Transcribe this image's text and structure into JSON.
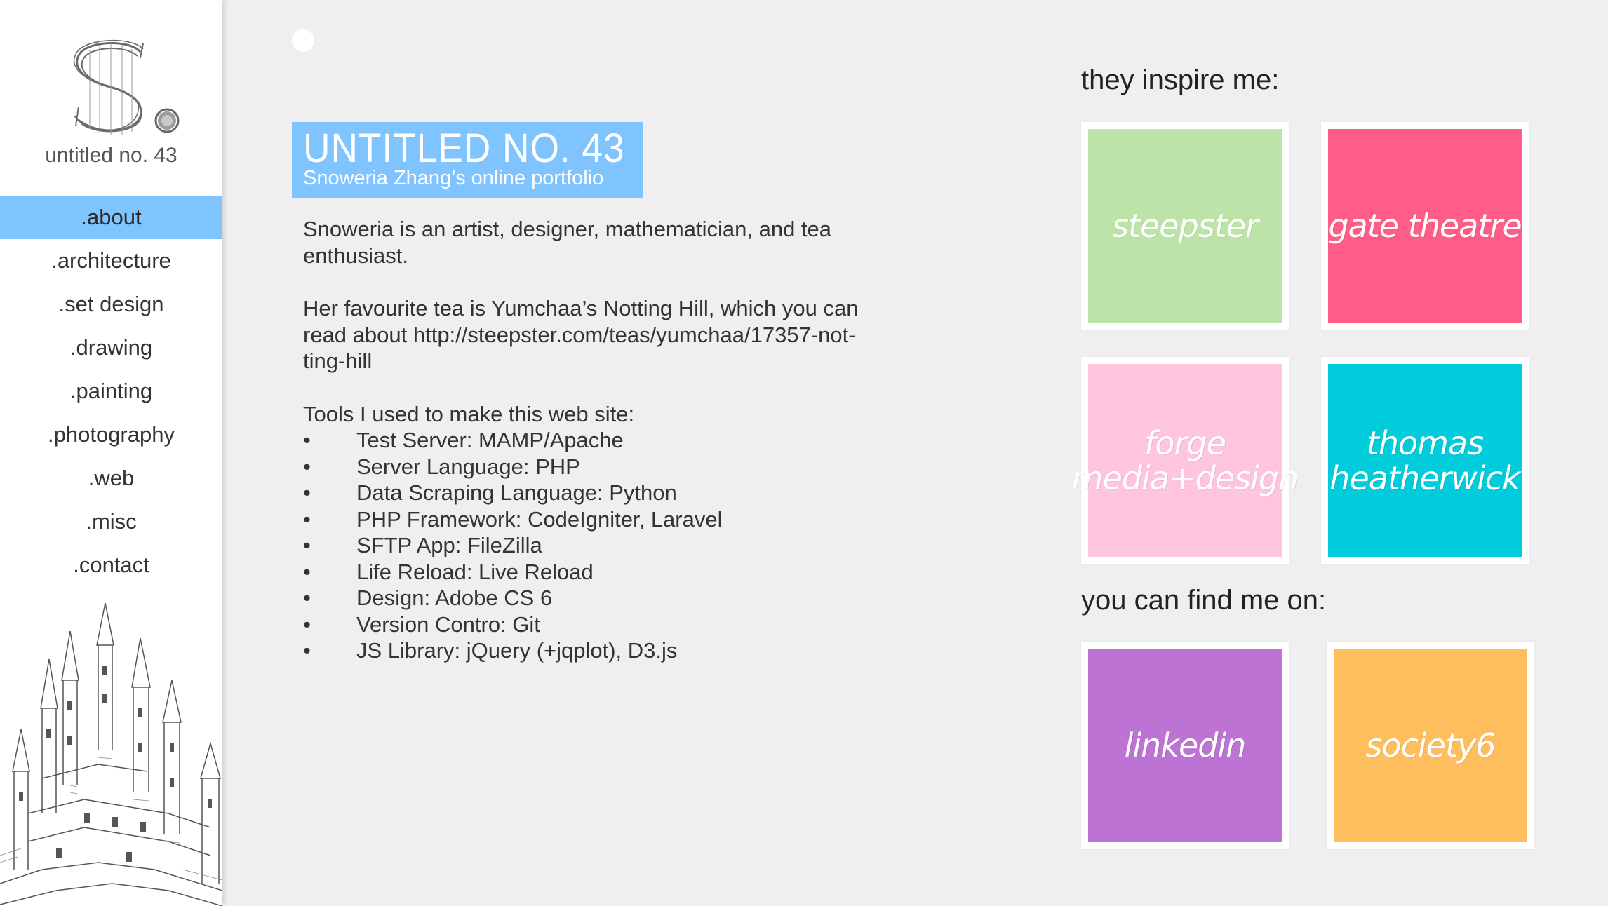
{
  "sidebar": {
    "logo_text": "S.",
    "site_name": "untitled no. 43",
    "nav": [
      {
        "label": ".about",
        "active": true
      },
      {
        "label": ".architecture"
      },
      {
        "label": ".set design"
      },
      {
        "label": ".drawing"
      },
      {
        "label": ".painting"
      },
      {
        "label": ".photography"
      },
      {
        "label": ".web"
      },
      {
        "label": ".misc"
      },
      {
        "label": ".contact"
      }
    ]
  },
  "header": {
    "title": "UNTITLED NO. 43",
    "subtitle": "Snoweria Zhang’s online portfolio"
  },
  "about": {
    "intro": "Snoweria is an artist, designer, mathematician, and tea enthusiast.",
    "tea_line1": "Her favourite tea is Yumchaa’s Notting Hill, which you can",
    "tea_line2": "read about http://steepster.com/teas/yumchaa/17357-not-",
    "tea_line3": "ting-hill",
    "tools_heading": "Tools I used to make this web site:",
    "bullet": "•",
    "tools": [
      "Test Server: MAMP/Apache",
      "Server Language: PHP",
      "Data Scraping Language: Python",
      "PHP Framework: CodeIgniter, Laravel",
      "SFTP App: FileZilla",
      "Life Reload: Live Reload",
      "Design: Adobe CS 6",
      "Version Contro: Git",
      "JS Library: jQuery (+jqplot), D3.js"
    ]
  },
  "inspire": {
    "heading": "they inspire me:",
    "tiles": [
      {
        "label": "steepster",
        "color": "#bde4a8"
      },
      {
        "label": "gate theatre",
        "color": "#ff5d87"
      },
      {
        "label": "forge media+design",
        "line1": "forge",
        "line2": "media+design",
        "color": "#ffc4de"
      },
      {
        "label": "thomas heatherwick",
        "line1": "thomas",
        "line2": "heatherwick",
        "color": "#00ccdb"
      }
    ]
  },
  "find": {
    "heading": "you can find me on:",
    "tiles": [
      {
        "label": "linkedin",
        "color": "#bc73d4"
      },
      {
        "label": "society6",
        "color": "#ffbe5e"
      }
    ]
  }
}
